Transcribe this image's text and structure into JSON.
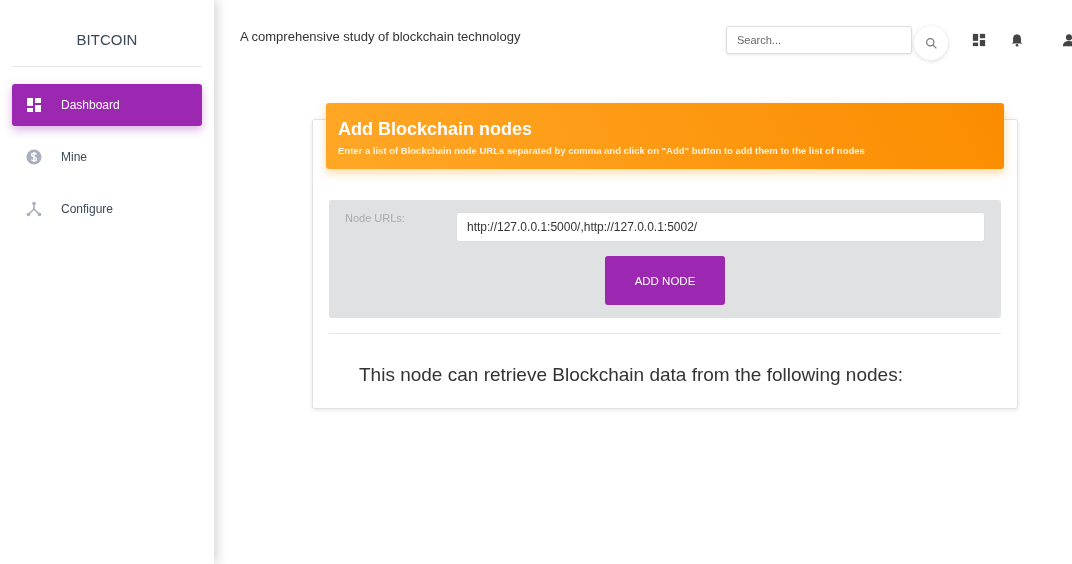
{
  "sidebar": {
    "brand": "BITCOIN",
    "items": [
      {
        "label": "Dashboard",
        "kind": "dashboard",
        "selected": true
      },
      {
        "label": "Mine",
        "kind": "dollar",
        "selected": false
      },
      {
        "label": "Configure",
        "kind": "branch",
        "selected": false
      }
    ]
  },
  "topbar": {
    "title": "A comprehensive study of blockchain technology",
    "search": {
      "placeholder": "Search..."
    }
  },
  "card": {
    "title": "Add Blockchain nodes",
    "subtitle": "Enter a list of Blockchain node URLs separated by comma and click on \"Add\" button to add them to the list of nodes",
    "form": {
      "label": "Node URLs:",
      "value": "http://127.0.0.1:5000/,http://127.0.0.1:5002/",
      "button": "ADD NODE"
    },
    "message": "This node can retrieve Blockchain data from the following nodes:"
  }
}
